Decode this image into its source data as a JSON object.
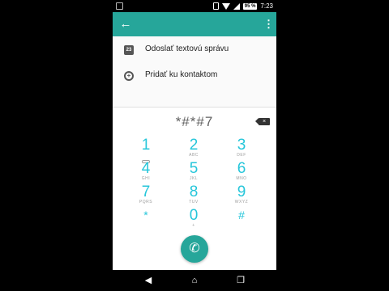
{
  "status": {
    "battery": "95 %",
    "time": "7:23"
  },
  "icons": {
    "back": "arrow-left-icon",
    "more": "more-vert-icon",
    "message": "message-icon",
    "contact": "add-contact-icon",
    "delete": "backspace-icon",
    "voicemail": "voicemail-icon",
    "call": "phone-icon",
    "nav_back": "nav-back-icon",
    "nav_home": "nav-home-icon",
    "nav_recent": "nav-recent-icon"
  },
  "colors": {
    "accent": "#26a69a",
    "keypad": "#26c6da"
  },
  "menu": [
    {
      "label": "Odoslať textovú správu"
    },
    {
      "label": "Pridať ku kontaktom"
    }
  ],
  "dialer": {
    "input": "*#*#7"
  },
  "keypad": [
    {
      "digit": "1",
      "letters": ""
    },
    {
      "digit": "2",
      "letters": "ABC"
    },
    {
      "digit": "3",
      "letters": "DEF"
    },
    {
      "digit": "4",
      "letters": "GHI"
    },
    {
      "digit": "5",
      "letters": "JKL"
    },
    {
      "digit": "6",
      "letters": "MNO"
    },
    {
      "digit": "7",
      "letters": "PQRS"
    },
    {
      "digit": "8",
      "letters": "TUV"
    },
    {
      "digit": "9",
      "letters": "WXYZ"
    },
    {
      "digit": "*",
      "letters": ""
    },
    {
      "digit": "0",
      "letters": "+"
    },
    {
      "digit": "#",
      "letters": ""
    }
  ]
}
